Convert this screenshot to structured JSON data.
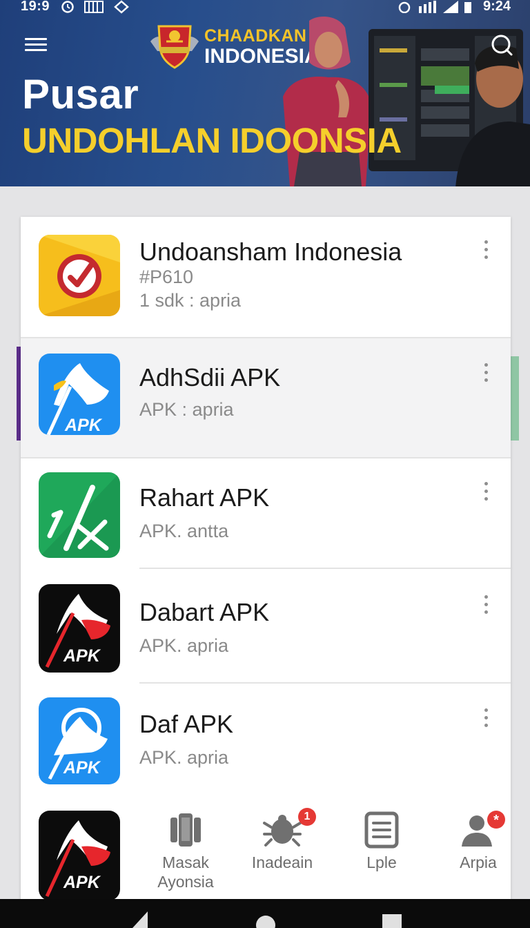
{
  "status_bar": {
    "time_left": "19:9",
    "time_right": "9:24"
  },
  "brand": {
    "line1": "CHAADKAN",
    "line2": "INDONESIA",
    "logo_icon": "crest-logo-icon"
  },
  "hero": {
    "title": "Pusar",
    "subtitle": "UNDOHLAN IDOONSIA"
  },
  "colors": {
    "hero_bg": "#274e8c",
    "accent_yellow": "#f5cf2c",
    "badge_red": "#e53935"
  },
  "apps": [
    {
      "name": "Undoansham Indonesia",
      "line2": "#P610",
      "line3": "1 sdk : apria",
      "icon": "red-check-app-icon"
    },
    {
      "name": "AdhSdii APK",
      "line2": "APK : apria",
      "icon": "blue-apk-app-icon",
      "badge_text": "APK"
    },
    {
      "name": "Rahart APK",
      "line2": "APK. antta",
      "icon": "green-app-icon"
    },
    {
      "name": "Dabart APK",
      "line2": "APK. apria",
      "icon": "black-apk-app-icon",
      "badge_text": "APK"
    },
    {
      "name": "Daf APK",
      "line2": "APK. apria",
      "icon": "blue-apk-app-icon",
      "badge_text": "APK"
    },
    {
      "name": "",
      "icon": "black-apk-app-icon",
      "badge_text": "APK"
    }
  ],
  "bottom_nav": [
    {
      "label": "Masak Ayonsia",
      "icon": "phone-icon"
    },
    {
      "label": "Inadeain",
      "icon": "bug-icon",
      "badge": "1"
    },
    {
      "label": "Lple",
      "icon": "list-icon"
    },
    {
      "label": "Arpia",
      "icon": "person-icon",
      "badge": "*"
    }
  ]
}
